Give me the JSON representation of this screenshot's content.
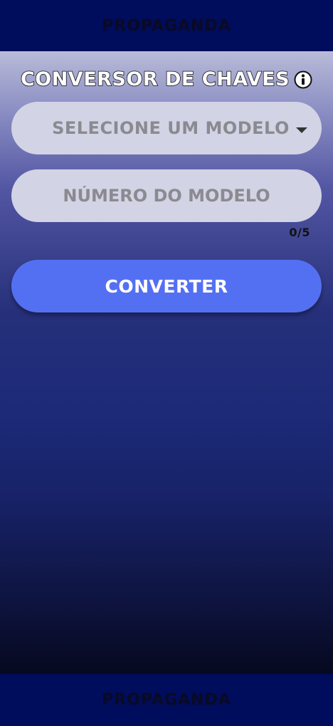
{
  "ads": {
    "top_label": "PROPAGANDA",
    "bottom_label": "PROPAGANDA"
  },
  "header": {
    "title": "CONVERSOR DE CHAVES",
    "info_icon": "info-icon"
  },
  "form": {
    "model_select": {
      "selected_label": "SELECIONE UM MODELO",
      "icon": "caret-down-icon"
    },
    "model_number": {
      "placeholder": "NÚMERO DO MODELO",
      "value": ""
    },
    "char_counter": "0/5",
    "convert_label": "CONVERTER"
  },
  "colors": {
    "ad_background": "#000c5c",
    "field_background": "#d2d3e5",
    "button_background": "#5470f2",
    "gradient_top": "#b9bbd8",
    "gradient_bottom": "#06091f"
  }
}
